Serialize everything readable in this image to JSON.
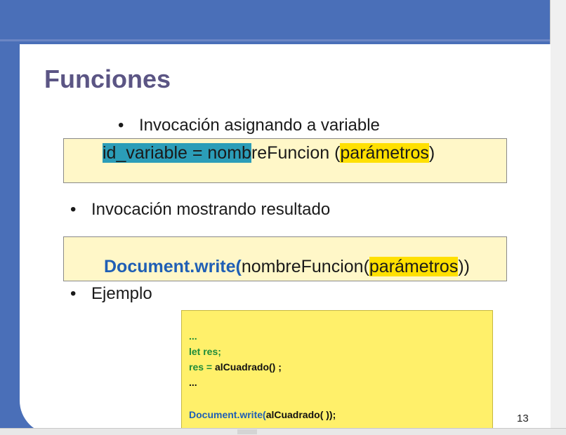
{
  "slide": {
    "title": "Funciones",
    "bullet1": "Invocación  asignando a variable",
    "code1": {
      "selected": "id_variable = nomb",
      "rest": "reFuncion (",
      "param": "parámetros",
      "close": ")"
    },
    "bullet2": "Invocación  mostrando resultado",
    "code2": {
      "keyword": "Document.write(",
      "fn": "nombreFuncion(",
      "param": "parámetros",
      "close": "))"
    },
    "bullet3": "Ejemplo",
    "example": {
      "l1": "...",
      "l2": "let res;",
      "l3a": "res = ",
      "l3b": "alCuadrado() ;",
      "l4": "...",
      "l5a": "Document.write(",
      "l5b": "alCuadrado( ));"
    },
    "page_number": "13"
  },
  "colors": {
    "background": "#4a6fb8",
    "title": "#5b5584",
    "selection": "#2b9db8",
    "highlight": "#ffe000",
    "keyword": "#1f5fb5"
  }
}
